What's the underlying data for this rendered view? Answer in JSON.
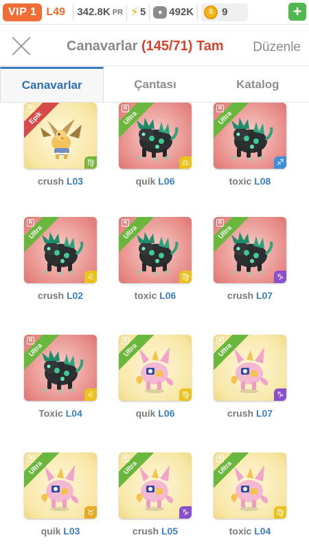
{
  "status": {
    "vip": "VIP 1",
    "level": "L49",
    "power": "342.8K",
    "power_unit": "PR",
    "energy": "5",
    "food": "492K",
    "gold": "9",
    "plus": "+"
  },
  "header": {
    "title": "Canavarlar",
    "count": "(145/71)",
    "full": "Tam",
    "edit": "Düzenle"
  },
  "tabs": [
    "Canavarlar",
    "Çantası",
    "Katalog"
  ],
  "colors": {
    "ultra": "#6ab73e",
    "epik": "#d84a4a",
    "level_blue": "#3b7fc4",
    "title_red": "#d9432b"
  },
  "monsters": [
    {
      "name": "crush",
      "level": "L03",
      "rarity": "Epik",
      "badge": "R",
      "theme": "yellow",
      "creature": "golden-griffin",
      "zodiac": "♍",
      "zodiac_color": "green"
    },
    {
      "name": "quik",
      "level": "L06",
      "rarity": "Ultra",
      "badge": "R",
      "theme": "pink",
      "creature": "dark-beast",
      "zodiac": "♎",
      "zodiac_color": "yellow"
    },
    {
      "name": "toxic",
      "level": "L08",
      "rarity": "Ultra",
      "badge": "R",
      "theme": "pink",
      "creature": "dark-beast",
      "zodiac": "♐",
      "zodiac_color": "blue"
    },
    {
      "name": "crush",
      "level": "L02",
      "rarity": "Ultra",
      "badge": "R",
      "theme": "pink",
      "creature": "dark-beast",
      "zodiac": "♌",
      "zodiac_color": "yellow"
    },
    {
      "name": "toxic",
      "level": "L06",
      "rarity": "Ultra",
      "badge": "R",
      "theme": "pink",
      "creature": "dark-beast",
      "zodiac": "♍",
      "zodiac_color": "yellow"
    },
    {
      "name": "crush",
      "level": "L07",
      "rarity": "Ultra",
      "badge": "R",
      "theme": "pink",
      "creature": "dark-beast",
      "zodiac": "♑",
      "zodiac_color": "purple"
    },
    {
      "name": "Toxic",
      "level": "L04",
      "rarity": "Ultra",
      "badge": "R",
      "theme": "pink",
      "creature": "dark-beast",
      "zodiac": "♌",
      "zodiac_color": "yellow"
    },
    {
      "name": "quik",
      "level": "L06",
      "rarity": "Ultra",
      "badge": "R",
      "theme": "yellow",
      "creature": "pink-dragon",
      "zodiac": "♍",
      "zodiac_color": "yellow"
    },
    {
      "name": "crush",
      "level": "L07",
      "rarity": "Ultra",
      "badge": "R",
      "theme": "yellow",
      "creature": "pink-dragon",
      "zodiac": "♑",
      "zodiac_color": "purple"
    },
    {
      "name": "quik",
      "level": "L03",
      "rarity": "Ultra",
      "badge": "R",
      "theme": "yellow",
      "creature": "pink-dragon",
      "zodiac": "♉",
      "zodiac_color": "orange"
    },
    {
      "name": "crush",
      "level": "L05",
      "rarity": "Ultra",
      "badge": "R",
      "theme": "yellow",
      "creature": "pink-dragon",
      "zodiac": "♑",
      "zodiac_color": "purple"
    },
    {
      "name": "toxic",
      "level": "L04",
      "rarity": "Ultra",
      "badge": "R",
      "theme": "yellow",
      "creature": "pink-dragon",
      "zodiac": "♍",
      "zodiac_color": "yellow"
    }
  ]
}
